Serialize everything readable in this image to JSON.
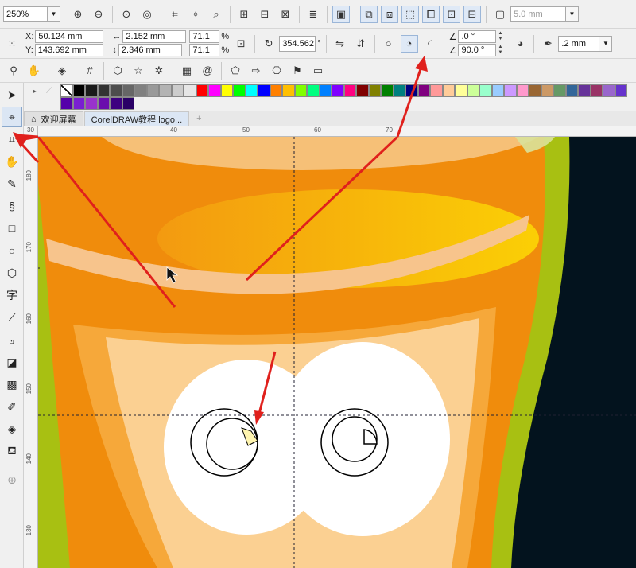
{
  "toolbar": {
    "zoom_value": "250%",
    "outline_width": "5.0 mm"
  },
  "property_bar": {
    "x_label": "X:",
    "x_value": "50.124 mm",
    "y_label": "Y:",
    "y_value": "143.692 mm",
    "width_value": "2.152 mm",
    "height_value": "2.346 mm",
    "scale_x": "71.1",
    "scale_y": "71.1",
    "pct": "%",
    "rotation": "354.562",
    "start_angle": ".0 °",
    "end_angle": "90.0 °",
    "outline": ".2 mm"
  },
  "tabs": [
    {
      "label": "欢迎屏幕"
    },
    {
      "label": "CorelDRAW教程 logo..."
    }
  ],
  "ruler": {
    "h_ticks": [
      "30",
      "40",
      "50",
      "60",
      "70"
    ],
    "v_ticks": [
      "180",
      "170",
      "160",
      "150",
      "140",
      "130"
    ]
  },
  "palette": [
    "#ffffff",
    "#000000",
    "#1a1a1a",
    "#333333",
    "#4d4d4d",
    "#666666",
    "#808080",
    "#999999",
    "#b3b3b3",
    "#cccccc",
    "#e6e6e6",
    "#ff0000",
    "#ff00ff",
    "#ffff00",
    "#00ff00",
    "#00ffff",
    "#0000ff",
    "#ff8000",
    "#ffbf00",
    "#80ff00",
    "#00ff80",
    "#0080ff",
    "#8000ff",
    "#ff0080",
    "#800000",
    "#808000",
    "#008000",
    "#008080",
    "#000080",
    "#800080",
    "#ff9999",
    "#ffcc99",
    "#ffff99",
    "#ccff99",
    "#99ffcc",
    "#99ccff",
    "#cc99ff",
    "#ff99cc",
    "#996633",
    "#cc9966",
    "#669966",
    "#336699",
    "#663399",
    "#993366",
    "#9966cc",
    "#6633cc",
    "#5500aa",
    "#7a1fd1",
    "#9932cc",
    "#6a0dad",
    "#3d0080",
    "#2a0066"
  ],
  "colors": {
    "canvas_bg": "#03131e",
    "outer_shape": "#a8c012",
    "body": "#f08c0c",
    "inner": "#fbc98a",
    "eye": "#ffffff",
    "arrow": "#e0201c"
  }
}
